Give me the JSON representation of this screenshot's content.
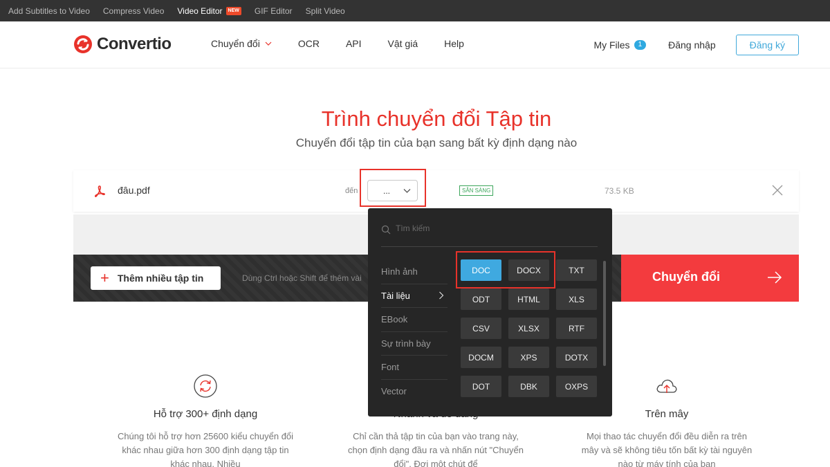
{
  "topbar": {
    "links": [
      {
        "label": "Add Subtitles to Video"
      },
      {
        "label": "Compress Video"
      },
      {
        "label": "Video Editor",
        "badge": "NEW"
      },
      {
        "label": "GIF Editor"
      },
      {
        "label": "Split Video"
      }
    ]
  },
  "header": {
    "brand": "Convertio",
    "nav": [
      "Chuyển đổi",
      "OCR",
      "API",
      "Vật giá",
      "Help"
    ],
    "my_files": "My Files",
    "my_files_count": "1",
    "login": "Đăng nhập",
    "signup": "Đăng ký"
  },
  "hero": {
    "title": "Trình chuyển đổi Tập tin",
    "subtitle": "Chuyển đổi tập tin của bạn sang bất kỳ định dạng nào"
  },
  "file": {
    "name": "đâu.pdf",
    "to_label": "đến",
    "selected_format": "...",
    "status": "SẴN SÀNG",
    "size": "73.5 KB"
  },
  "actions": {
    "add_files": "Thêm nhiều tập tin",
    "hint": "Dùng Ctrl hoặc Shift để thêm vài",
    "convert": "Chuyển đổi"
  },
  "dropdown": {
    "search_placeholder": "Tìm kiếm",
    "categories": [
      "Hình ảnh",
      "Tài liệu",
      "EBook",
      "Sự trình bày",
      "Font",
      "Vector"
    ],
    "active_category": "Tài liệu",
    "formats": [
      "DOC",
      "DOCX",
      "TXT",
      "ODT",
      "HTML",
      "XLS",
      "CSV",
      "XLSX",
      "RTF",
      "DOCM",
      "XPS",
      "DOTX",
      "DOT",
      "DBK",
      "OXPS"
    ],
    "selected_format": "DOC"
  },
  "features": [
    {
      "title": "Hỗ trợ 300+ định dạng",
      "desc": "Chúng tôi hỗ trợ hơn 25600 kiểu chuyển đổi khác nhau giữa hơn 300 định dạng tập tin khác nhau. Nhiều"
    },
    {
      "title": "Nhanh và dễ dàng",
      "desc": "Chỉ cần thả tập tin của bạn vào trang này, chọn định dạng đầu ra và nhấn nút \"Chuyển đổi\". Đợi một chút để"
    },
    {
      "title": "Trên mây",
      "desc": "Mọi thao tác chuyển đổi đều diễn ra trên mây và sẽ không tiêu tốn bất kỳ tài nguyên nào từ máy tính của bạn"
    }
  ],
  "colors": {
    "brand_red": "#e8322a",
    "accent_blue": "#3fa9e0",
    "convert_red": "#f33b3e",
    "status_green": "#3ca65b"
  }
}
